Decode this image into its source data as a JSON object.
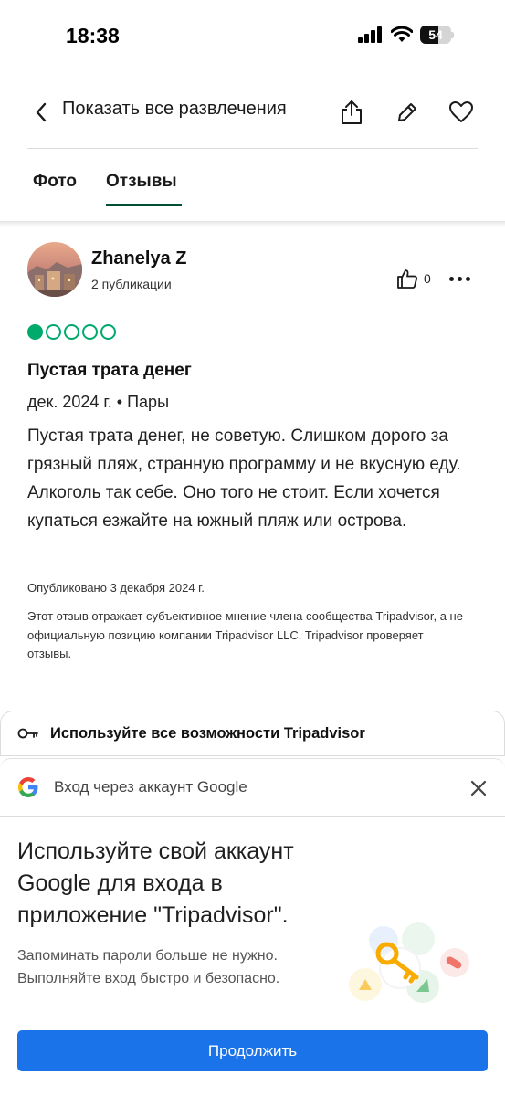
{
  "status_bar": {
    "time": "18:38",
    "battery": "54"
  },
  "header": {
    "back_label": "Показать все развлечения",
    "icons": [
      "share-icon",
      "edit-icon",
      "heart-icon"
    ]
  },
  "tabs": [
    {
      "label": "Фото"
    },
    {
      "label": "Отзывы"
    }
  ],
  "review": {
    "author": "Zhanelya Z",
    "posts": "2 публикации",
    "likes": "0",
    "rating": 1,
    "rating_max": 5,
    "title": "Пустая трата денег",
    "meta": "дек. 2024 г. • Пары",
    "body": "Пустая трата денег, не советую. Слишком дорого за грязный пляж, странную программу и не вкусную еду. Алкоголь так себе. Оно того не стоит. Если хочется купаться езжайте на южный пляж или острова.",
    "published": "Опубликовано 3 декабря 2024 г.",
    "disclaimer": "Этот отзыв отражает субъективное мнение члена сообщества Tripadvisor, а не официальную позицию компании Tripadvisor LLC. Tripadvisor проверяет отзывы."
  },
  "banner": {
    "text": "Используйте все возможности Tripadvisor"
  },
  "google_sheet": {
    "header": "Вход через аккаунт Google",
    "title": "Используйте свой аккаунт Google для входа в приложение \"Tripadvisor\".",
    "description": "Запоминать пароли больше не нужно. Выполняйте вход быстро и безопасно.",
    "continue_label": "Продолжить"
  },
  "colors": {
    "tripadvisor_green": "#00aa6c",
    "tab_underline": "#004f32",
    "google_blue": "#1a73e8"
  }
}
